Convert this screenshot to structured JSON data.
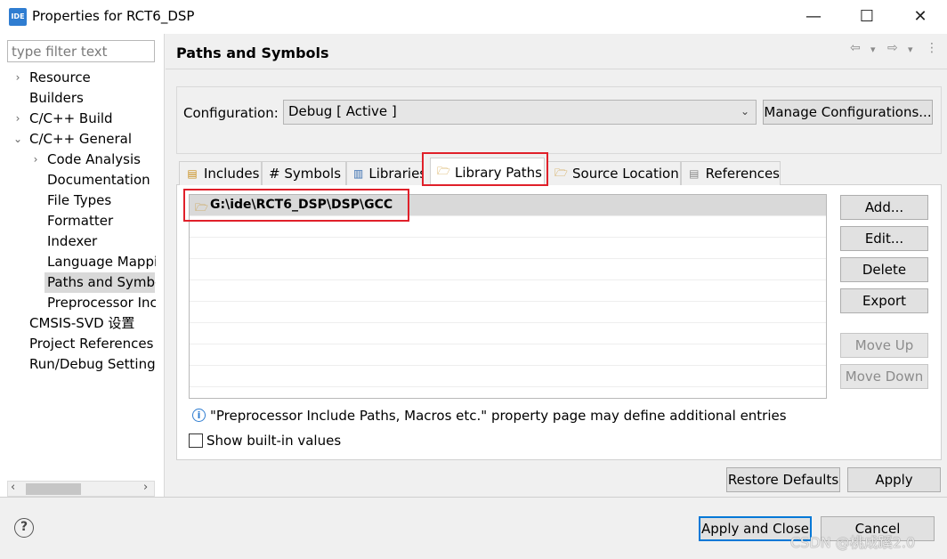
{
  "window": {
    "icon_text": "IDE",
    "title": "Properties for RCT6_DSP",
    "controls": {
      "minimize": "—",
      "maximize": "☐",
      "close": "✕"
    }
  },
  "filter": {
    "placeholder": "type filter text",
    "value": ""
  },
  "tree": {
    "items": [
      {
        "label": "Resource",
        "arrow": "›"
      },
      {
        "label": "Builders",
        "arrow": ""
      },
      {
        "label": "C/C++ Build",
        "arrow": "›"
      },
      {
        "label": "C/C++ General",
        "arrow": "⌄"
      },
      {
        "label": "Code Analysis",
        "arrow": "›"
      },
      {
        "label": "Documentation",
        "arrow": ""
      },
      {
        "label": "File Types",
        "arrow": ""
      },
      {
        "label": "Formatter",
        "arrow": ""
      },
      {
        "label": "Indexer",
        "arrow": ""
      },
      {
        "label": "Language Mappi",
        "arrow": ""
      },
      {
        "label": "Paths and Symbo",
        "arrow": ""
      },
      {
        "label": "Preprocessor Inc",
        "arrow": ""
      },
      {
        "label": "CMSIS-SVD 设置",
        "arrow": ""
      },
      {
        "label": "Project References",
        "arrow": ""
      },
      {
        "label": "Run/Debug Setting",
        "arrow": ""
      }
    ],
    "selected_index": 10,
    "scroll_left": "‹",
    "scroll_right": "›"
  },
  "page": {
    "title": "Paths and Symbols",
    "nav": {
      "back": "⇦",
      "back_menu": "▾",
      "forward": "⇨",
      "forward_menu": "▾",
      "more": "⋮"
    }
  },
  "configuration": {
    "label": "Configuration:",
    "value": "Debug  [ Active ]",
    "caret": "⌄",
    "manage_button": "Manage Configurations..."
  },
  "tabs": [
    {
      "label": "Includes",
      "icon": "includes-icon",
      "glyph": "▤"
    },
    {
      "label": "# Symbols",
      "icon": "hash-icon",
      "glyph": ""
    },
    {
      "label": "Libraries",
      "icon": "library-icon",
      "glyph": "▥"
    },
    {
      "label": "Library Paths",
      "icon": "folder-icon",
      "glyph": "🗁",
      "active": true
    },
    {
      "label": "Source Location",
      "icon": "folder-icon",
      "glyph": "🗁"
    },
    {
      "label": "References",
      "icon": "references-icon",
      "glyph": "▤"
    }
  ],
  "paths": [
    {
      "label": "G:\\ide\\RCT6_DSP\\DSP\\GCC",
      "icon": "folder-icon",
      "glyph": "🗁"
    }
  ],
  "side_buttons": {
    "add": "Add...",
    "edit": "Edit...",
    "delete": "Delete",
    "export": "Export",
    "move_up": "Move Up",
    "move_down": "Move Down"
  },
  "info": {
    "icon": "ⓘ",
    "text": "\"Preprocessor Include Paths, Macros etc.\" property page may define additional entries"
  },
  "show_builtin": {
    "label": "Show built-in values",
    "checked": false
  },
  "page_buttons": {
    "restore_defaults": "Restore Defaults",
    "apply": "Apply"
  },
  "footer": {
    "help": "?",
    "apply_and_close": "Apply and Close",
    "cancel": "Cancel",
    "watermark": "CSDN @桃成蹊2.0"
  },
  "colors": {
    "highlight_box": "#e0202a",
    "selection": "#d9d9d9",
    "default_button_border": "#0078d7"
  }
}
